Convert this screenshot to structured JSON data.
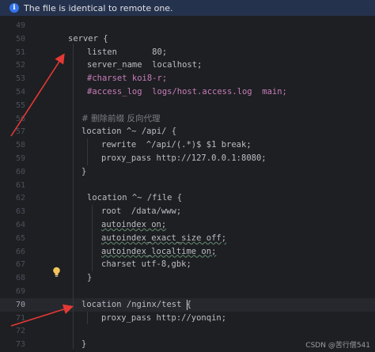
{
  "banner": {
    "text": "The file is identical to remote one.",
    "icon": "info-icon"
  },
  "editor": {
    "current_line": "70",
    "lines": [
      {
        "num": "49",
        "indent": 0,
        "text": ""
      },
      {
        "num": "50",
        "indent": 0,
        "text": "server {"
      },
      {
        "num": "51",
        "indent": 1,
        "text": "listen       80;"
      },
      {
        "num": "52",
        "indent": 1,
        "text": "server_name  localhost;"
      },
      {
        "num": "53",
        "indent": 1,
        "text": "#charset koi8-r;",
        "kind": "comment"
      },
      {
        "num": "54",
        "indent": 1,
        "text": "#access_log  logs/host.access.log  main;",
        "kind": "comment"
      },
      {
        "num": "55",
        "indent": 0,
        "text": ""
      },
      {
        "num": "56",
        "indent": 1,
        "text": "# 删除前缀 反向代理",
        "kind": "zh"
      },
      {
        "num": "57",
        "indent": 1,
        "text": "location ^~ /api/ {"
      },
      {
        "num": "58",
        "indent": 2,
        "text": "rewrite  ^/api/(.*)$ $1 break;"
      },
      {
        "num": "59",
        "indent": 2,
        "text": "proxy_pass http://127.0.0.1:8080;"
      },
      {
        "num": "60",
        "indent": 1,
        "text": "}"
      },
      {
        "num": "61",
        "indent": 0,
        "text": ""
      },
      {
        "num": "62",
        "indent": 1,
        "text": "location ^~ /file {"
      },
      {
        "num": "63",
        "indent": 2,
        "text": "root  /data/www;"
      },
      {
        "num": "64",
        "indent": 2,
        "text": "autoindex on;",
        "kind": "underline"
      },
      {
        "num": "65",
        "indent": 2,
        "text": "autoindex_exact_size off;",
        "kind": "underline"
      },
      {
        "num": "66",
        "indent": 2,
        "text": "autoindex_localtime on;",
        "kind": "underline"
      },
      {
        "num": "67",
        "indent": 2,
        "text": "charset utf-8,gbk;"
      },
      {
        "num": "68",
        "indent": 1,
        "text": "}"
      },
      {
        "num": "69",
        "indent": 0,
        "text": ""
      },
      {
        "num": "70",
        "indent": 1,
        "text": "location /nginx/test {"
      },
      {
        "num": "71",
        "indent": 2,
        "text": "proxy_pass http://yonqin;"
      },
      {
        "num": "72",
        "indent": 0,
        "text": ""
      },
      {
        "num": "73",
        "indent": 1,
        "text": "}"
      }
    ]
  },
  "watermark": "CSDN @苦行僧541",
  "colors": {
    "background": "#1e1f22",
    "text": "#bcbec4",
    "comment": "#c77dbb",
    "banner": "#25324d",
    "arrow": "#e53935"
  }
}
